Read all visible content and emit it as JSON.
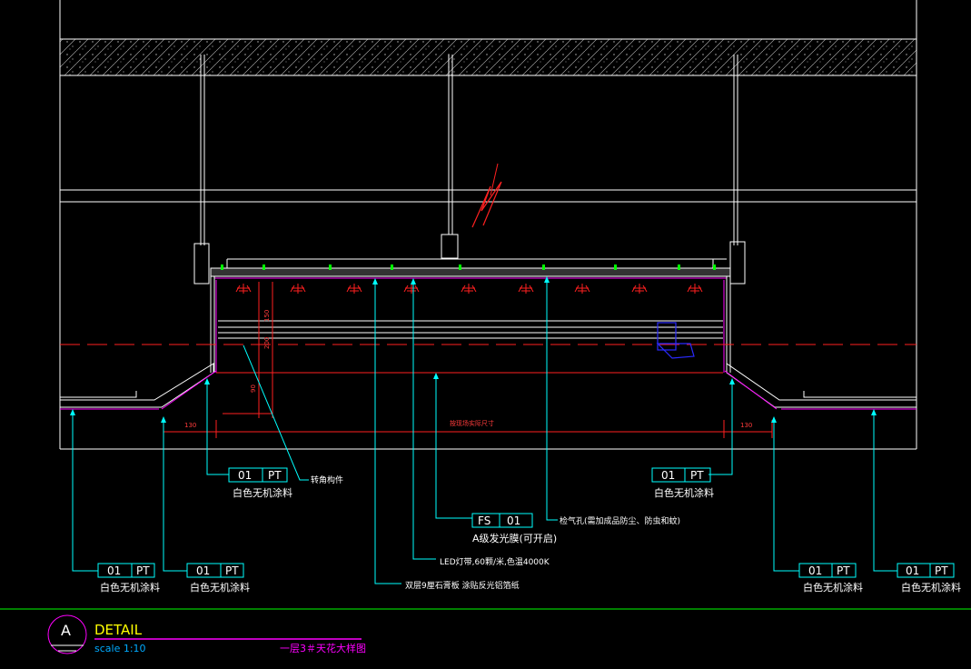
{
  "colors": {
    "background": "#000000",
    "line": "#ffffff",
    "leader": "#00ffff",
    "red": "#ff2020",
    "green": "#00ff00",
    "magenta": "#ff00ff",
    "blue": "#2a2aff"
  },
  "tags": {
    "left_inner": {
      "code": "01",
      "type": "PT",
      "desc": "白色无机涂料"
    },
    "right_inner": {
      "code": "01",
      "type": "PT",
      "desc": "白色无机涂料"
    },
    "far_left": {
      "code": "01",
      "type": "PT",
      "desc": "白色无机涂料"
    },
    "left_b": {
      "code": "01",
      "type": "PT",
      "desc": "白色无机涂料"
    },
    "right_b": {
      "code": "01",
      "type": "PT",
      "desc": "白色无机涂料"
    },
    "far_right": {
      "code": "01",
      "type": "PT",
      "desc": "白色无机涂料"
    },
    "film": {
      "code": "FS",
      "type": "01",
      "desc": "A级发光膜(可开启)"
    }
  },
  "notes": {
    "bracket": "转角构件",
    "vent": "检气孔(需加成品防尘、防虫和蚊)",
    "led": "LED灯带,60颗/米,色温4000K",
    "board": "双层9厘石膏板 涂贴反光铝箔纸",
    "center_dim": "按现场实际尺寸"
  },
  "dims": {
    "left_130": "130",
    "right_130": "130",
    "v_150": "150",
    "v_200": "200",
    "v_90": "90"
  },
  "title_block": {
    "symbol": "A",
    "title": "DETAIL",
    "scale": "scale  1:10",
    "caption": "一层3＃天花大样图"
  }
}
